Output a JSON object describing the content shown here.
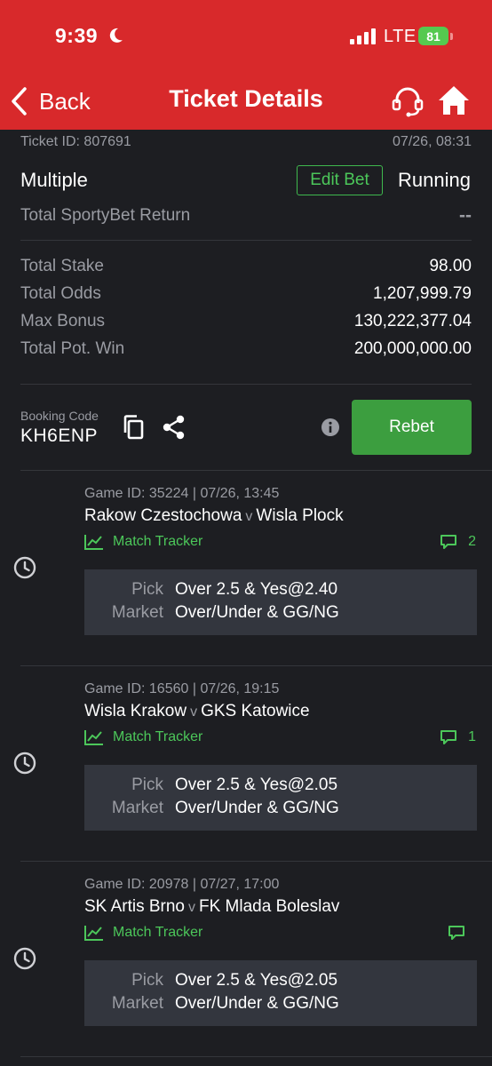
{
  "status_bar": {
    "time": "9:39",
    "network": "LTE",
    "battery": "81"
  },
  "header": {
    "back_label": "Back",
    "title": "Ticket Details"
  },
  "ticket": {
    "id_text": "Ticket ID: 807691",
    "datetime": "07/26, 08:31",
    "type": "Multiple",
    "edit_bet_label": "Edit Bet",
    "status": "Running",
    "return_label": "Total SportyBet Return",
    "return_value": "--",
    "stake_label": "Total Stake",
    "stake_value": "98.00",
    "odds_label": "Total Odds",
    "odds_value": "1,207,999.79",
    "bonus_label": "Max Bonus",
    "bonus_value": "130,222,377.04",
    "potwin_label": "Total Pot. Win",
    "potwin_value": "200,000,000.00"
  },
  "booking": {
    "label": "Booking Code",
    "code": "KH6ENP",
    "rebet_label": "Rebet"
  },
  "games": [
    {
      "meta": "Game ID: 35224 | 07/26, 13:45",
      "home": "Rakow Czestochowa",
      "vs": "v",
      "away": "Wisla Plock",
      "tracker_label": "Match Tracker",
      "comments": "2",
      "pick_label": "Pick",
      "pick_value": "Over 2.5 & Yes@2.40",
      "market_label": "Market",
      "market_value": "Over/Under & GG/NG"
    },
    {
      "meta": "Game ID: 16560 | 07/26, 19:15",
      "home": "Wisla Krakow",
      "vs": "v",
      "away": "GKS Katowice",
      "tracker_label": "Match Tracker",
      "comments": "1",
      "pick_label": "Pick",
      "pick_value": "Over 2.5 & Yes@2.05",
      "market_label": "Market",
      "market_value": "Over/Under & GG/NG"
    },
    {
      "meta": "Game ID: 20978 | 07/27, 17:00",
      "home": "SK Artis Brno",
      "vs": "v",
      "away": "FK Mlada Boleslav",
      "tracker_label": "Match Tracker",
      "comments": "",
      "pick_label": "Pick",
      "pick_value": "Over 2.5 & Yes@2.05",
      "market_label": "Market",
      "market_value": "Over/Under & GG/NG"
    }
  ],
  "colors": {
    "header": "#d8292b",
    "background": "#1d1e22",
    "accent_green": "#4cc75a",
    "rebet": "#3c9e3f",
    "pick_box": "#33363e"
  }
}
